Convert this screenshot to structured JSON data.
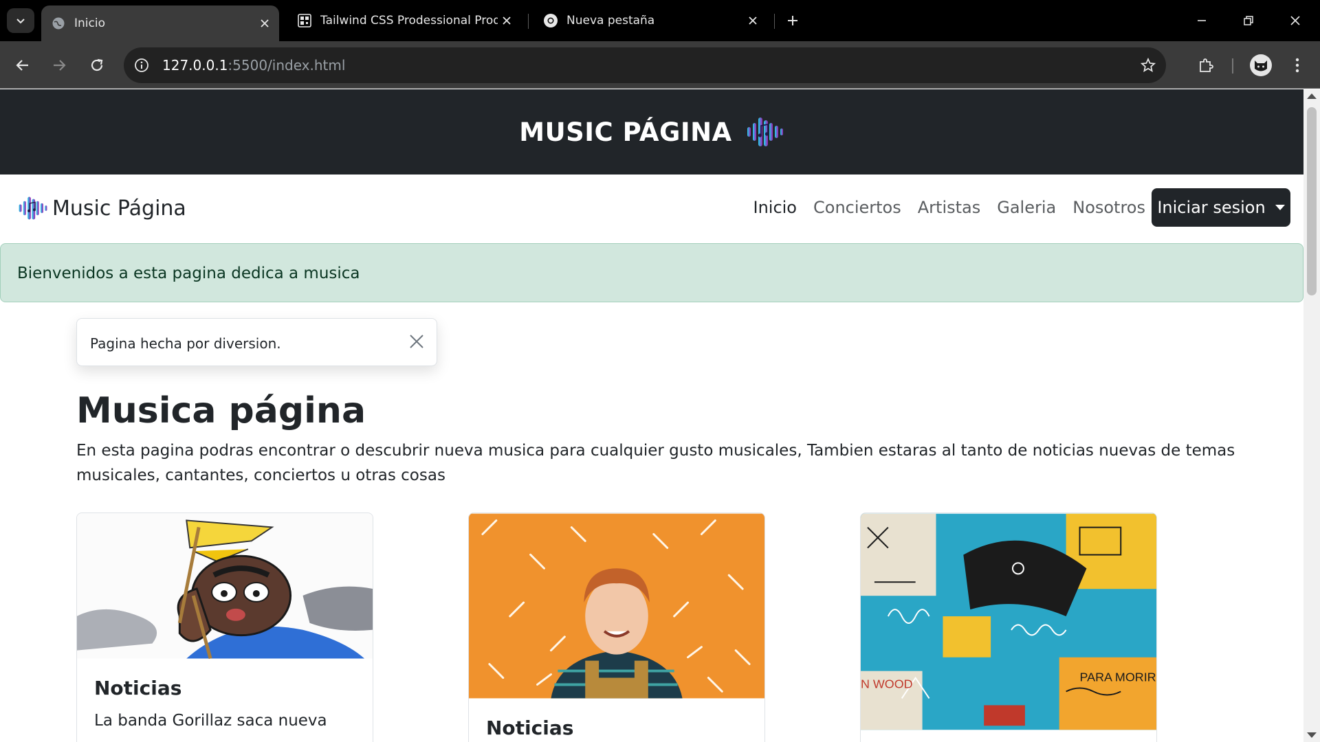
{
  "browser": {
    "tabs": [
      {
        "title": "Inicio",
        "active": true
      },
      {
        "title": "Tailwind CSS Prodessional Prod",
        "active": false
      },
      {
        "title": "Nueva pestaña",
        "active": false
      }
    ],
    "url_host": "127.0.0.1",
    "url_path": ":5500/index.html"
  },
  "hero": {
    "title": "MUSIC PÁGINA"
  },
  "navbar": {
    "brand": "Music Página",
    "links": [
      "Inicio",
      "Conciertos",
      "Artistas",
      "Galeria",
      "Nosotros"
    ],
    "login_label": "Iniciar sesion"
  },
  "alert": {
    "text": "Bienvenidos a esta pagina dedica a musica"
  },
  "toast": {
    "text": "Pagina hecha por diversion."
  },
  "main": {
    "title": "Musica página",
    "lead": "En esta pagina podras encontrar o descubrir nueva musica para cualquier gusto musicales, Tambien estaras al tanto de noticias nuevas de temas musicales, cantantes, conciertos u otras cosas"
  },
  "cards": [
    {
      "title": "Noticias",
      "text": "La banda Gorillaz saca nueva"
    },
    {
      "title": "Noticias",
      "text": ""
    },
    {
      "title": "",
      "text": ""
    }
  ],
  "colors": {
    "hero_bg": "#212529",
    "alert_bg": "#d1e7dd",
    "logo_gradient_start": "#22d3ee",
    "logo_gradient_end": "#a21caf"
  }
}
